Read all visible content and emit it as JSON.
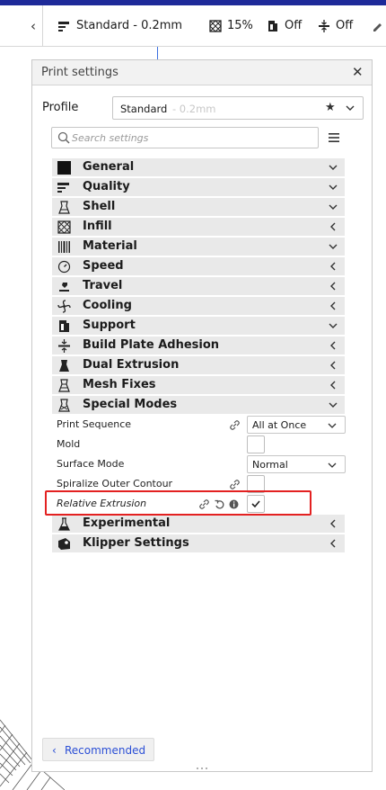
{
  "header": {
    "profile": "Standard - 0.2mm",
    "infill_value": "15%",
    "support_value": "Off",
    "adhesion_value": "Off"
  },
  "panel": {
    "title": "Print settings",
    "close_glyph": "✕",
    "profile_label": "Profile",
    "profile_name": "Standard",
    "profile_sub": "- 0.2mm",
    "search_placeholder": "Search settings"
  },
  "categories": [
    {
      "label": "General",
      "icon": "general-icon",
      "state": "expanded"
    },
    {
      "label": "Quality",
      "icon": "quality-icon",
      "state": "expanded"
    },
    {
      "label": "Shell",
      "icon": "shell-icon",
      "state": "expanded"
    },
    {
      "label": "Infill",
      "icon": "infill-icon",
      "state": "collapsed"
    },
    {
      "label": "Material",
      "icon": "material-icon",
      "state": "expanded"
    },
    {
      "label": "Speed",
      "icon": "speed-icon",
      "state": "collapsed"
    },
    {
      "label": "Travel",
      "icon": "travel-icon",
      "state": "collapsed"
    },
    {
      "label": "Cooling",
      "icon": "cooling-icon",
      "state": "collapsed"
    },
    {
      "label": "Support",
      "icon": "support-icon",
      "state": "expanded"
    },
    {
      "label": "Build Plate Adhesion",
      "icon": "adhesion-icon",
      "state": "collapsed"
    },
    {
      "label": "Dual Extrusion",
      "icon": "dual-extrusion-icon",
      "state": "collapsed"
    },
    {
      "label": "Mesh Fixes",
      "icon": "mesh-fixes-icon",
      "state": "collapsed"
    },
    {
      "label": "Special Modes",
      "icon": "special-modes-icon",
      "state": "expanded"
    }
  ],
  "special_modes": {
    "print_sequence": {
      "label": "Print Sequence",
      "value": "All at Once"
    },
    "mold": {
      "label": "Mold"
    },
    "surface_mode": {
      "label": "Surface Mode",
      "value": "Normal"
    },
    "spiralize": {
      "label": "Spiralize Outer Contour"
    },
    "relative_extrusion": {
      "label": "Relative Extrusion",
      "checked": true
    }
  },
  "bottom_categories": [
    {
      "label": "Experimental",
      "icon": "experimental-icon",
      "state": "collapsed"
    },
    {
      "label": "Klipper Settings",
      "icon": "klipper-icon",
      "state": "collapsed"
    }
  ],
  "footer": {
    "recommended_label": "Recommended",
    "recommended_glyph": "‹"
  },
  "colors": {
    "accent": "#2b4fd6",
    "topbar": "#1e2a99",
    "highlight": "#e32121"
  }
}
